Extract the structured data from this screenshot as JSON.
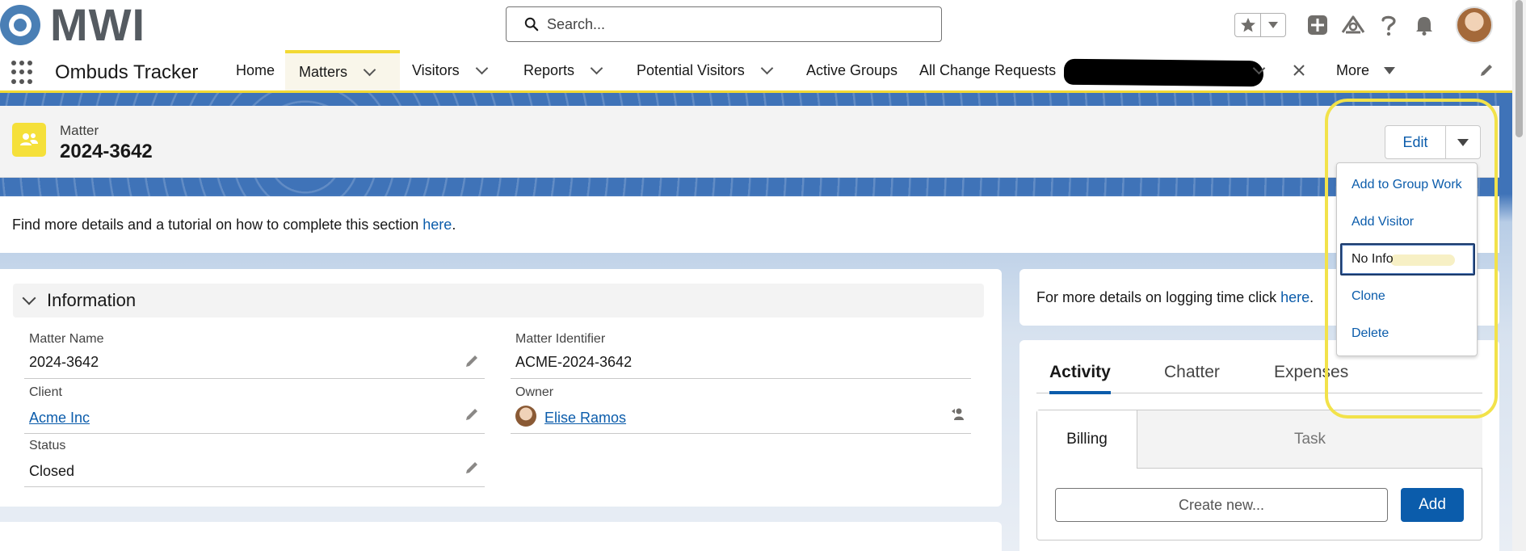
{
  "header": {
    "logo_text": "MWI",
    "search": {
      "placeholder": "Search..."
    }
  },
  "nav": {
    "app_name": "Ombuds Tracker",
    "items": [
      {
        "label": "Home"
      },
      {
        "label": "Matters",
        "active": true
      },
      {
        "label": "Visitors"
      },
      {
        "label": "Reports"
      },
      {
        "label": "Potential Visitors"
      },
      {
        "label": "Active Groups"
      },
      {
        "label": "All Change Requests"
      }
    ],
    "more_label": "More"
  },
  "record": {
    "type_label": "Matter",
    "title": "2024-3642",
    "edit_label": "Edit"
  },
  "banner": {
    "text": "Find more details and a tutorial on how to complete this section ",
    "link_text": "here",
    "suffix": "."
  },
  "information": {
    "section_title": "Information",
    "fields": {
      "matter_name": {
        "label": "Matter Name",
        "value": "2024-3642"
      },
      "matter_identifier": {
        "label": "Matter Identifier",
        "value": "ACME-2024-3642"
      },
      "client": {
        "label": "Client",
        "value": "Acme Inc"
      },
      "owner": {
        "label": "Owner",
        "value": "Elise Ramos"
      },
      "status": {
        "label": "Status",
        "value": "Closed"
      }
    }
  },
  "time_card": {
    "text": "For more details on logging time click ",
    "link_text": "here",
    "suffix": "."
  },
  "activity": {
    "tabs": [
      {
        "label": "Activity",
        "active": true
      },
      {
        "label": "Chatter"
      },
      {
        "label": "Expenses"
      }
    ],
    "sub_tabs": [
      {
        "label": "Billing",
        "active": true
      },
      {
        "label": "Task"
      }
    ],
    "create_placeholder": "Create new...",
    "add_label": "Add"
  },
  "dropdown": {
    "items": [
      {
        "label": "Add to Group Work"
      },
      {
        "label": "Add Visitor"
      },
      {
        "label": "No Info",
        "focused": true
      },
      {
        "label": "Clone"
      },
      {
        "label": "Delete"
      }
    ]
  },
  "colors": {
    "brand_blue": "#0b5cab",
    "nav_accent_yellow": "#f2d933",
    "record_icon_yellow": "#f5e03a",
    "annotation_yellow": "#f2e24a",
    "band_blue": "#3f73b8"
  },
  "icons": {
    "search": "search-icon",
    "favorites": "star-icon",
    "new": "plus-square-icon",
    "trailhead": "trailhead-icon",
    "help": "question-mark-icon",
    "notifications": "bell-icon",
    "app_launcher": "waffle-grid-icon",
    "nav_edit": "pencil-icon",
    "record": "group-people-icon",
    "field_edit": "pencil-icon",
    "change_owner": "change-owner-icon"
  }
}
